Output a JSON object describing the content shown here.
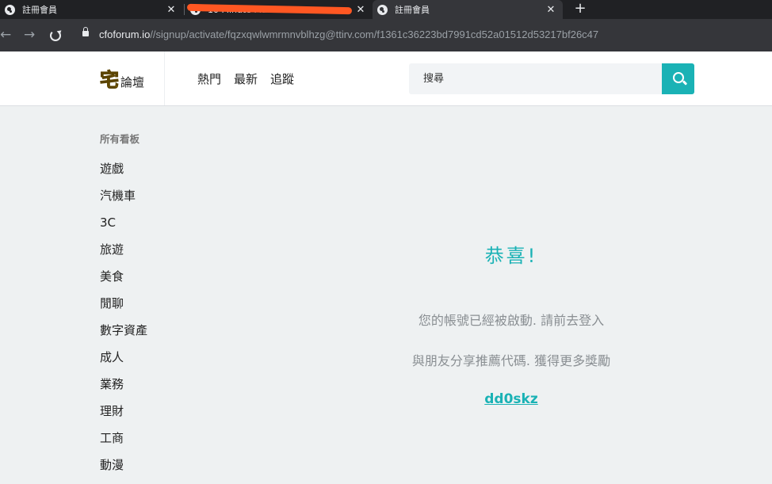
{
  "browser": {
    "tabs": [
      {
        "title": "註冊會員",
        "close": "✕"
      },
      {
        "title": "10 Minute Mail",
        "close": "✕"
      },
      {
        "title": "註冊會員",
        "close": "✕"
      }
    ],
    "new_tab": "+",
    "url": {
      "host": "cfoforum.io",
      "path": "//signup/activate/fqzxqwlwmrmnvblhzg@ttirv.com/f1361c36223bd7991cd52a01512d53217bf26c47"
    }
  },
  "header": {
    "logo_mark": "宅",
    "logo_text": "論壇",
    "nav": [
      "熱門",
      "最新",
      "追蹤"
    ],
    "search_placeholder": "搜尋"
  },
  "sidebar": {
    "heading": "所有看板",
    "items": [
      "遊戲",
      "汽機車",
      "3C",
      "旅遊",
      "美食",
      "閒聊",
      "數字資產",
      "成人",
      "業務",
      "理財",
      "工商",
      "動漫"
    ]
  },
  "main": {
    "title": "恭喜!",
    "message_activated": "您的帳號已經被啟動. 請前去登入",
    "message_share": "與朋友分享推薦代碼. 獲得更多獎勵",
    "referral_code": "dd0skz"
  }
}
